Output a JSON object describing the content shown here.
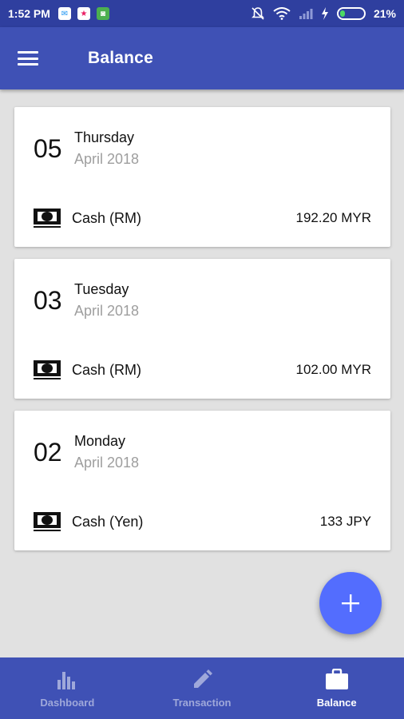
{
  "status_bar": {
    "time": "1:52 PM",
    "battery": "21%",
    "battery_level": 0.21
  },
  "app_bar": {
    "title": "Balance",
    "menu_icon": "hamburger-icon"
  },
  "entries": [
    {
      "day": "05",
      "weekday": "Thursday",
      "month": "April 2018",
      "account": "Cash (RM)",
      "amount": "192.20 MYR",
      "icon": "cash-icon"
    },
    {
      "day": "03",
      "weekday": "Tuesday",
      "month": "April 2018",
      "account": "Cash (RM)",
      "amount": "102.00 MYR",
      "icon": "cash-icon"
    },
    {
      "day": "02",
      "weekday": "Monday",
      "month": "April 2018",
      "account": "Cash (Yen)",
      "amount": "133 JPY",
      "icon": "cash-icon"
    }
  ],
  "fab": {
    "icon": "plus-icon"
  },
  "bottom_nav": {
    "items": [
      {
        "label": "Dashboard",
        "icon": "bar-chart-icon",
        "active": false
      },
      {
        "label": "Transaction",
        "icon": "pencil-icon",
        "active": false
      },
      {
        "label": "Balance",
        "icon": "briefcase-icon",
        "active": true
      }
    ]
  },
  "colors": {
    "primary": "#3f51b5",
    "status_bar": "#2f3f9f",
    "accent": "#536dfe",
    "background": "#e1e1e1"
  }
}
